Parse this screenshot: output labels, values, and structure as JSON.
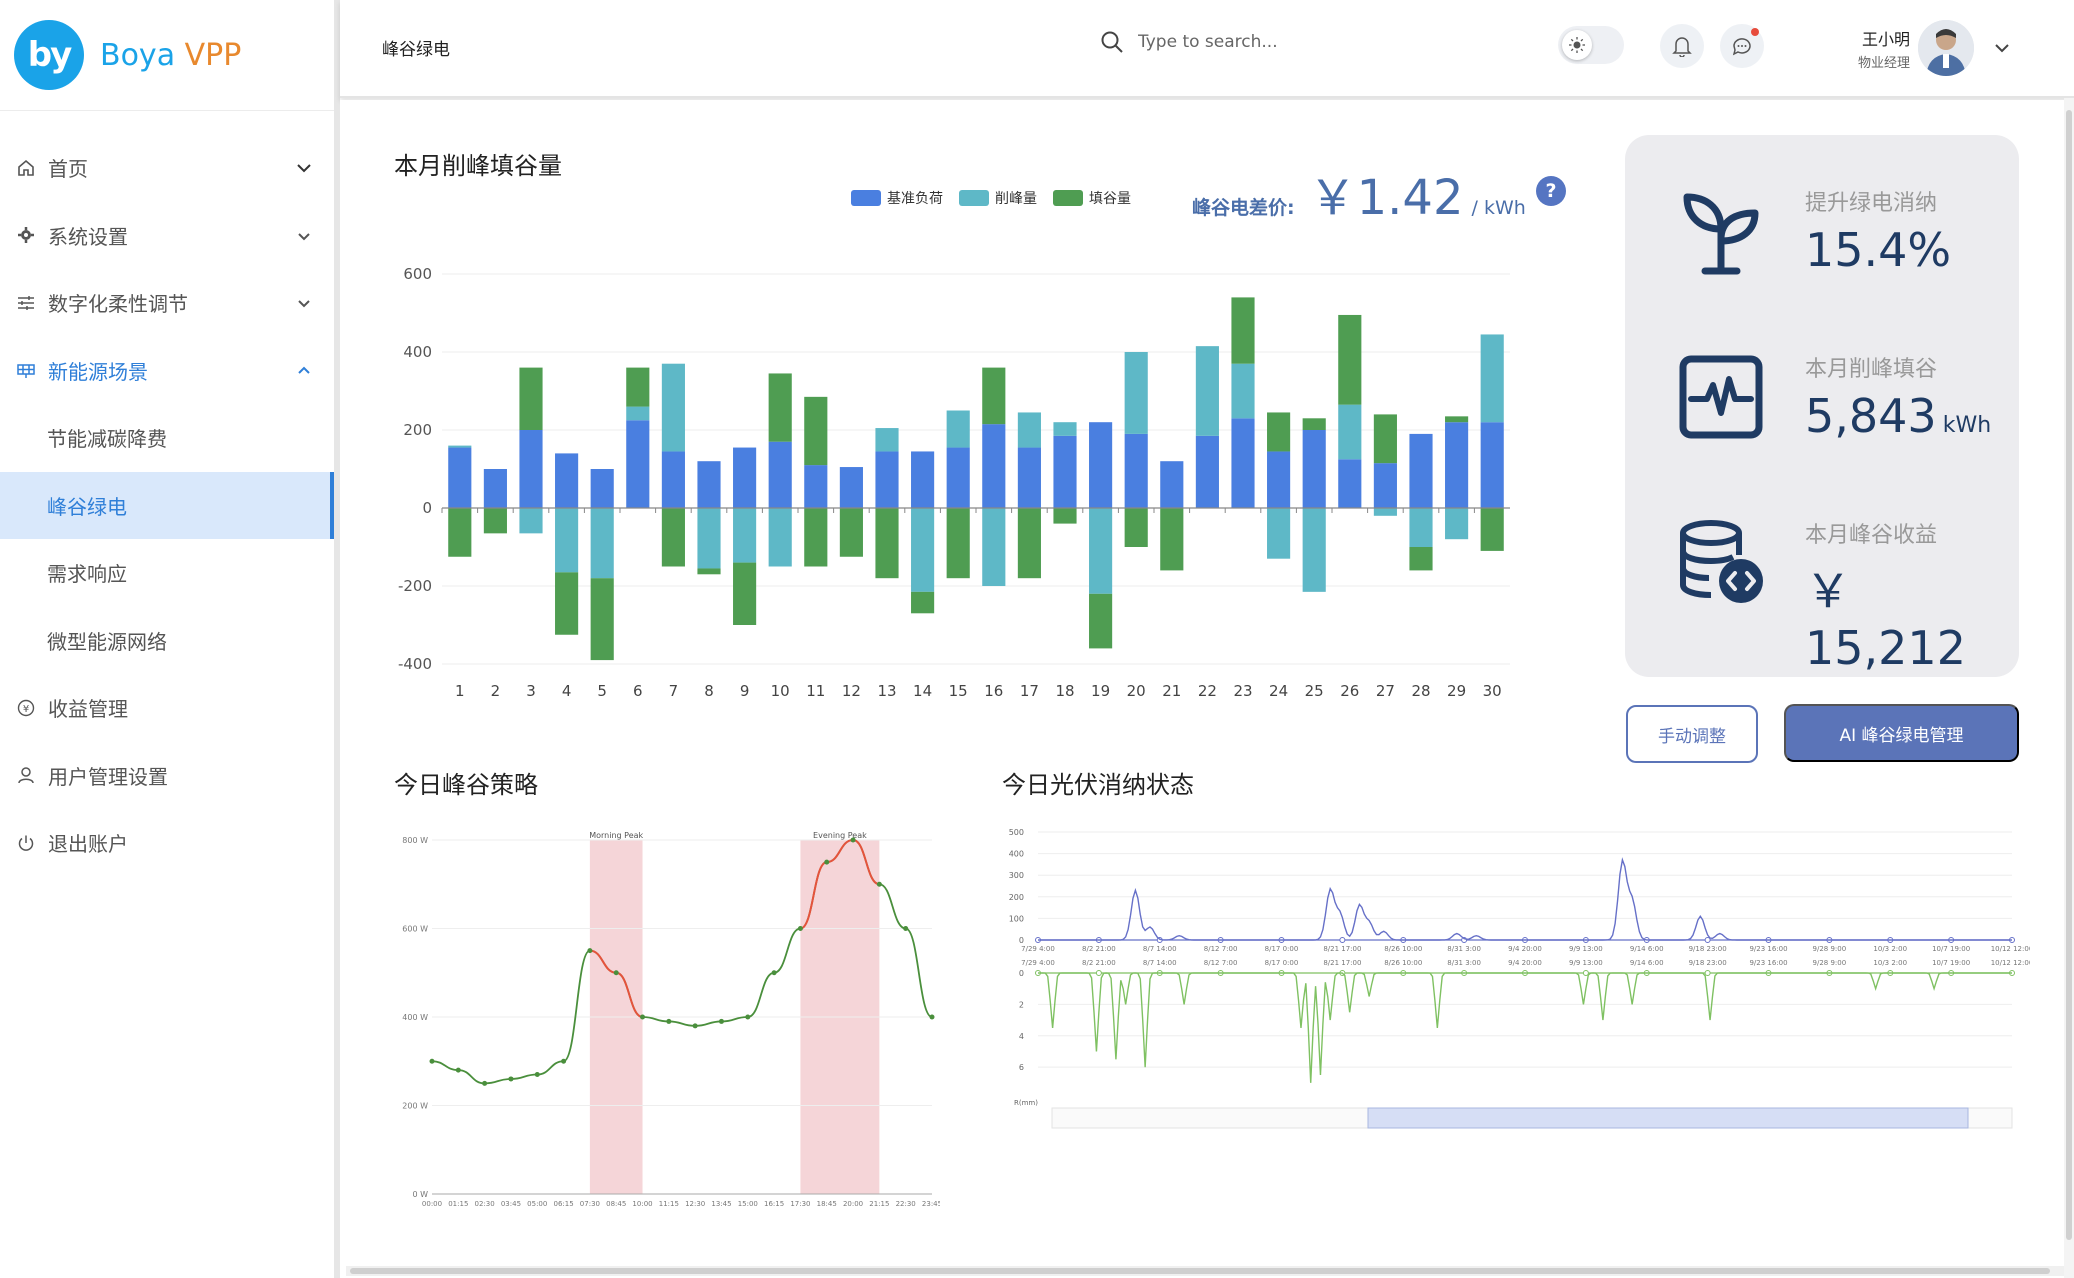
{
  "brand": {
    "logo_mark": "by",
    "name": "Boya",
    "suffix": "VPP"
  },
  "sidebar": {
    "items": [
      {
        "label": "首页",
        "icon": "home-icon"
      },
      {
        "label": "系统设置",
        "icon": "gear-icon"
      },
      {
        "label": "数字化柔性调节",
        "icon": "sliders-icon"
      },
      {
        "label": "新能源场景",
        "icon": "grid-icon"
      },
      {
        "label": "节能减碳降费"
      },
      {
        "label": "峰谷绿电"
      },
      {
        "label": "需求响应"
      },
      {
        "label": "微型能源网络"
      },
      {
        "label": "收益管理",
        "icon": "yen-circle-icon"
      },
      {
        "label": "用户管理设置",
        "icon": "user-icon"
      },
      {
        "label": "退出账户",
        "icon": "power-icon"
      }
    ]
  },
  "header": {
    "title": "峰谷绿电",
    "search_placeholder": "Type to search...",
    "user_name": "王小明",
    "user_role": "物业经理"
  },
  "monthly": {
    "title": "本月削峰填谷量",
    "legend": [
      "基准负荷",
      "削峰量",
      "填谷量"
    ],
    "price_label": "峰谷电差价:",
    "price_value": "￥1.42",
    "price_unit": "/ kWh",
    "help": "?"
  },
  "colors": {
    "base": "#4a7fe0",
    "shave": "#5eb8c7",
    "fill": "#4f9d52",
    "accent": "#5b74b8",
    "peak_band": "#f5d5d8",
    "pv_line": "#6670c8",
    "rain_line": "#7fc162"
  },
  "chart_data": [
    {
      "type": "bar",
      "title": "本月削峰填谷量",
      "categories": [
        "1",
        "2",
        "3",
        "4",
        "5",
        "6",
        "7",
        "8",
        "9",
        "10",
        "11",
        "12",
        "13",
        "14",
        "15",
        "16",
        "17",
        "18",
        "19",
        "20",
        "21",
        "22",
        "23",
        "24",
        "25",
        "26",
        "27",
        "28",
        "29",
        "30"
      ],
      "y_ticks": [
        "600",
        "400",
        "200",
        "0",
        "-200",
        "-400"
      ],
      "ylim": [
        -400,
        600
      ],
      "series": [
        {
          "name": "基准负荷",
          "values": [
            155,
            100,
            200,
            140,
            100,
            225,
            145,
            120,
            155,
            170,
            110,
            105,
            145,
            145,
            155,
            215,
            155,
            185,
            220,
            190,
            120,
            185,
            230,
            145,
            200,
            125,
            115,
            190,
            220,
            220
          ]
        },
        {
          "name": "削峰量",
          "values": [
            5,
            0,
            0,
            0,
            0,
            35,
            225,
            0,
            0,
            0,
            0,
            0,
            60,
            0,
            95,
            0,
            90,
            35,
            0,
            210,
            0,
            230,
            140,
            0,
            0,
            140,
            0,
            0,
            0,
            225
          ]
        },
        {
          "name": "填谷量",
          "values": [
            0,
            0,
            160,
            0,
            0,
            100,
            0,
            0,
            0,
            175,
            175,
            0,
            0,
            0,
            0,
            145,
            0,
            0,
            0,
            0,
            0,
            0,
            170,
            100,
            30,
            230,
            125,
            0,
            15,
            0
          ]
        },
        {
          "name": "削峰量(负)",
          "values": [
            0,
            0,
            -65,
            -165,
            -180,
            0,
            0,
            -155,
            -140,
            -150,
            0,
            0,
            0,
            -215,
            0,
            -200,
            0,
            0,
            -220,
            0,
            0,
            0,
            0,
            -130,
            -215,
            0,
            -20,
            -100,
            -80,
            0
          ]
        },
        {
          "name": "填谷量(负)",
          "values": [
            -125,
            -65,
            0,
            -160,
            -210,
            0,
            -150,
            -15,
            -160,
            0,
            -150,
            -125,
            -180,
            -55,
            -180,
            0,
            -180,
            -40,
            -140,
            -100,
            -160,
            0,
            0,
            0,
            0,
            0,
            0,
            -60,
            0,
            -110
          ]
        }
      ]
    },
    {
      "type": "line",
      "title": "今日峰谷策略",
      "bands": [
        "Morning Peak",
        "Evening Peak"
      ],
      "y_ticks": [
        "800 W",
        "600 W",
        "400 W",
        "200 W",
        "0 W"
      ],
      "ylim": [
        0,
        800
      ],
      "x": [
        "00:00",
        "01:15",
        "02:30",
        "03:45",
        "05:00",
        "06:15",
        "07:30",
        "08:45",
        "10:00",
        "11:15",
        "12:30",
        "13:45",
        "15:00",
        "16:15",
        "17:30",
        "18:45",
        "20:00",
        "21:15",
        "22:30",
        "23:45"
      ],
      "values": [
        300,
        280,
        250,
        260,
        270,
        300,
        550,
        500,
        400,
        390,
        380,
        390,
        400,
        500,
        600,
        750,
        800,
        700,
        600,
        400
      ]
    },
    {
      "type": "line",
      "title": "今日光伏消纳状态",
      "y_ticks_top": [
        "500",
        "400",
        "300",
        "200",
        "100",
        "0"
      ],
      "y_ticks_bottom": [
        "0",
        "2",
        "4",
        "6"
      ],
      "bottom_ylabel": "R(mm)",
      "x": [
        "7/29 4:00",
        "8/2 21:00",
        "8/7 14:00",
        "8/12 7:00",
        "8/17 0:00",
        "8/21 17:00",
        "8/26 10:00",
        "8/31 3:00",
        "9/4 20:00",
        "9/9 13:00",
        "9/14 6:00",
        "9/18 23:00",
        "9/23 16:00",
        "9/28 9:00",
        "10/3 2:00",
        "10/7 19:00",
        "10/12 12:00"
      ]
    }
  ],
  "stats": [
    {
      "label": "提升绿电消纳",
      "value": "15.4%",
      "unit": "",
      "icon": "sprout-icon"
    },
    {
      "label": "本月削峰填谷",
      "value": "5,843",
      "unit": "kWh",
      "icon": "pulse-monitor-icon"
    },
    {
      "label": "本月峰谷收益",
      "value": "￥ 15,212",
      "unit": "",
      "icon": "coins-icon"
    }
  ],
  "actions": {
    "manual": "手动调整",
    "ai": "AI 峰谷绿电管理"
  },
  "strategy": {
    "title": "今日峰谷策略"
  },
  "pv": {
    "title": "今日光伏消纳状态"
  }
}
